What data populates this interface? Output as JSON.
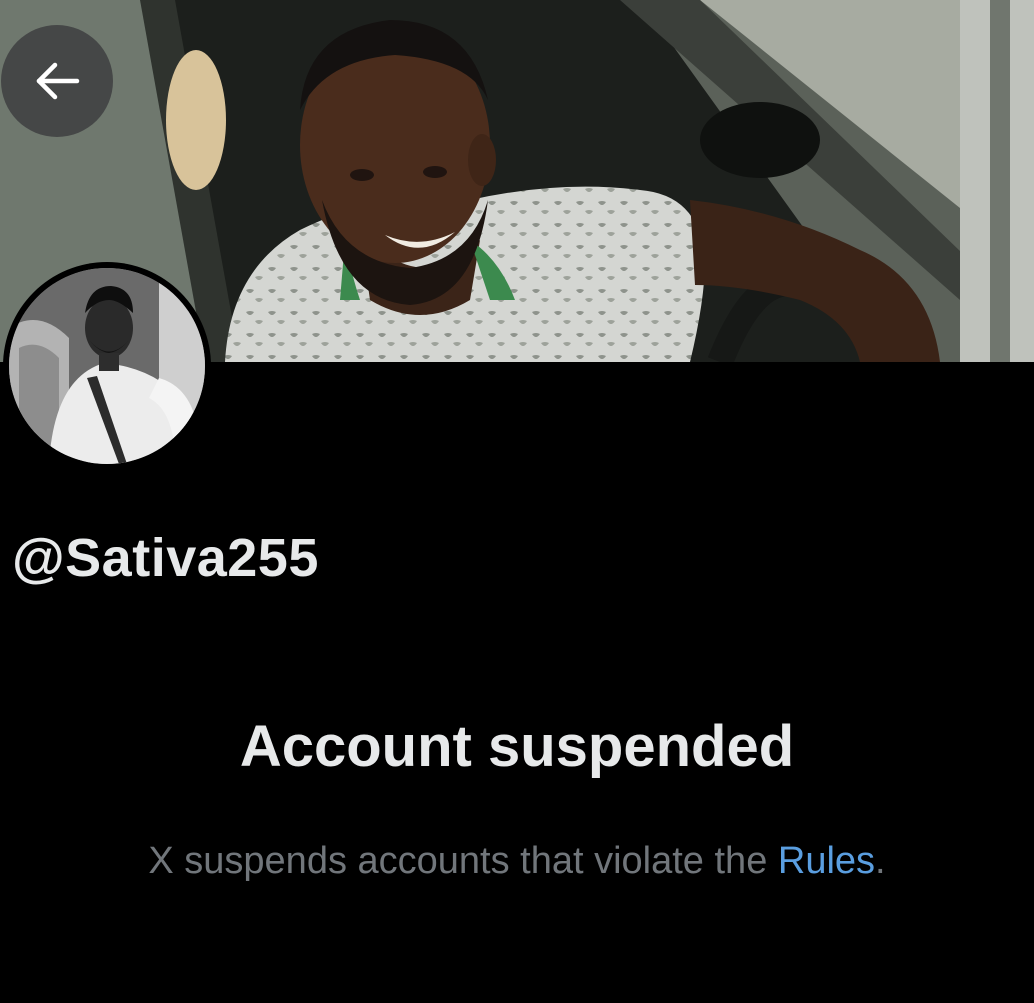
{
  "profile": {
    "handle": "@Sativa255"
  },
  "suspension": {
    "title": "Account suspended",
    "message_prefix": "X suspends accounts that violate the ",
    "rules_link": "Rules",
    "message_suffix": "."
  },
  "icons": {
    "back": "arrow-left-icon"
  },
  "colors": {
    "background": "#000000",
    "primary_text": "#e7e9ea",
    "secondary_text": "#71767b",
    "link": "#5a9ee0"
  }
}
